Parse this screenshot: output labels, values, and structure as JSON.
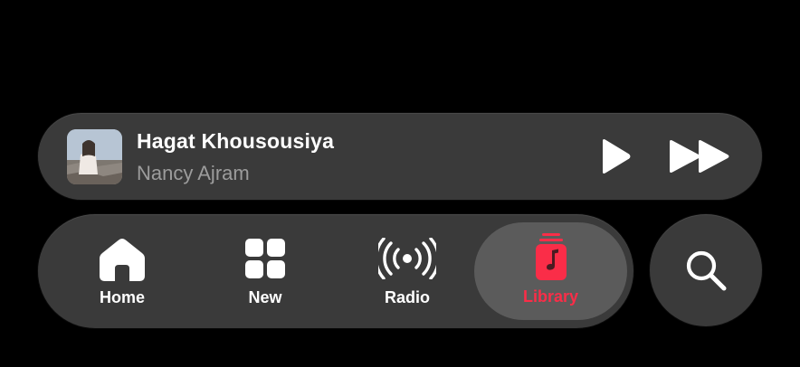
{
  "now_playing": {
    "title": "Hagat Khousousiya",
    "artist": "Nancy Ajram",
    "artwork_icon": "album-artwork",
    "controls": {
      "play_icon": "play-icon",
      "next_icon": "fast-forward-icon"
    }
  },
  "tabs": [
    {
      "label": "Home",
      "icon": "house-icon",
      "selected": false
    },
    {
      "label": "New",
      "icon": "grid-icon",
      "selected": false
    },
    {
      "label": "Radio",
      "icon": "broadcast-icon",
      "selected": false
    },
    {
      "label": "Library",
      "icon": "music-library-icon",
      "selected": true
    }
  ],
  "search": {
    "icon": "search-icon"
  },
  "colors": {
    "background": "#000000",
    "surface": "#3a3a3a",
    "selected_tab": "#5b5b5b",
    "accent": "#fa2d48",
    "primary_text": "#ffffff",
    "secondary_text": "#9c9c9c"
  }
}
